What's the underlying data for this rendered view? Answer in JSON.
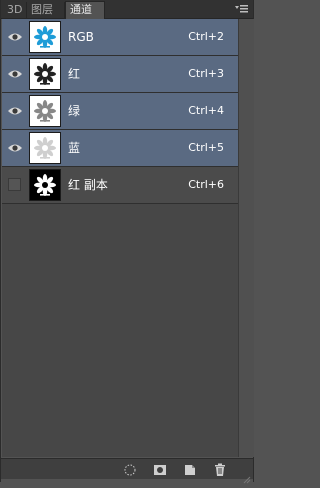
{
  "tabs": [
    {
      "label": "3D"
    },
    {
      "label": "图层"
    },
    {
      "label": "通道"
    }
  ],
  "menu_icon": "panel-menu-icon",
  "channels": [
    {
      "name": "RGB",
      "shortcut": "Ctrl+2",
      "visible": true,
      "selected": true,
      "thumb_color": "#1e9cd7",
      "thumb_bg": "#ffffff"
    },
    {
      "name": "红",
      "shortcut": "Ctrl+3",
      "visible": true,
      "selected": true,
      "thumb_color": "#222222",
      "thumb_bg": "#ffffff"
    },
    {
      "name": "绿",
      "shortcut": "Ctrl+4",
      "visible": true,
      "selected": true,
      "thumb_color": "#888888",
      "thumb_bg": "#ffffff"
    },
    {
      "name": "蓝",
      "shortcut": "Ctrl+5",
      "visible": true,
      "selected": true,
      "thumb_color": "#cfcfcf",
      "thumb_bg": "#ffffff"
    },
    {
      "name": "红 副本",
      "shortcut": "Ctrl+6",
      "visible": false,
      "selected": false,
      "thumb_color": "#ffffff",
      "thumb_bg": "#000000"
    }
  ],
  "bottom_tools": [
    {
      "icon": "load-selection-icon"
    },
    {
      "icon": "save-selection-as-channel-icon"
    },
    {
      "icon": "new-channel-icon"
    },
    {
      "icon": "delete-channel-icon"
    }
  ],
  "colors": {
    "selected_row": "#5a6a82",
    "panel_bg": "#474747"
  }
}
